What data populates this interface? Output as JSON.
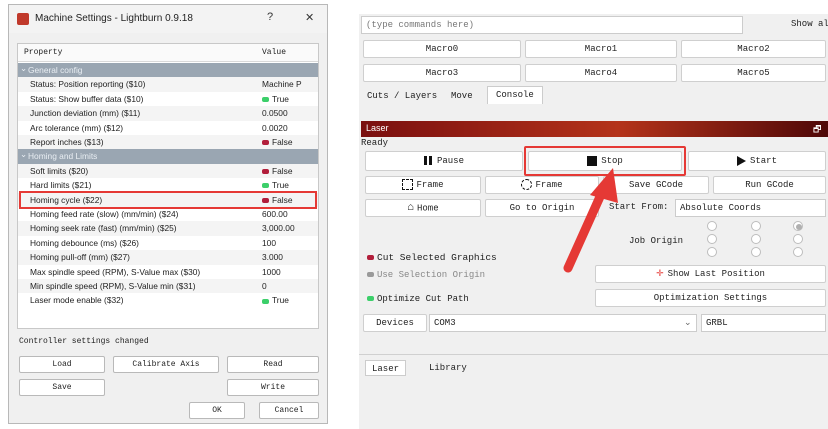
{
  "dialog": {
    "title": "Machine Settings - Lightburn 0.9.18",
    "help": "?",
    "close": "✕",
    "columns": {
      "property": "Property",
      "value": "Value"
    },
    "rows": [
      {
        "type": "section",
        "k": "General config",
        "v": ""
      },
      {
        "k": "Status: Position reporting ($10)",
        "v": "Machine P",
        "ind": ""
      },
      {
        "k": "Status: Show buffer data ($10)",
        "v": "True",
        "ind": "green"
      },
      {
        "k": "Junction deviation (mm) ($11)",
        "v": "0.0500",
        "ind": ""
      },
      {
        "k": "Arc tolerance (mm) ($12)",
        "v": "0.0020",
        "ind": ""
      },
      {
        "k": "Report inches ($13)",
        "v": "False",
        "ind": "red"
      },
      {
        "type": "section",
        "k": "Homing and Limits",
        "v": ""
      },
      {
        "k": "Soft limits ($20)",
        "v": "False",
        "ind": "red"
      },
      {
        "k": "Hard limits ($21)",
        "v": "True",
        "ind": "green"
      },
      {
        "k": "Homing cycle ($22)",
        "v": "False",
        "ind": "red",
        "highlight": true
      },
      {
        "k": "Homing feed rate (slow) (mm/min) ($24)",
        "v": "600.00",
        "ind": ""
      },
      {
        "k": "Homing seek rate (fast) (mm/min) ($25)",
        "v": "3,000.00",
        "ind": ""
      },
      {
        "k": "Homing debounce (ms) ($26)",
        "v": "100",
        "ind": ""
      },
      {
        "k": "Homing pull-off (mm) ($27)",
        "v": "3.000",
        "ind": ""
      },
      {
        "k": "Max spindle speed (RPM), S-Value max ($30)",
        "v": "1000",
        "ind": ""
      },
      {
        "k": "Min spindle speed (RPM), S-Value min ($31)",
        "v": "0",
        "ind": ""
      },
      {
        "k": "Laser mode enable ($32)",
        "v": "True",
        "ind": "green"
      }
    ],
    "status": "Controller settings changed",
    "buttons": {
      "load": "Load",
      "calibrate": "Calibrate Axis",
      "read": "Read",
      "save": "Save",
      "write": "Write",
      "ok": "OK",
      "cancel": "Cancel"
    }
  },
  "console": {
    "placeholder": "(type commands here)",
    "show_all": "Show all",
    "macros": [
      "Macro0",
      "Macro1",
      "Macro2",
      "Macro3",
      "Macro4",
      "Macro5"
    ],
    "tabs": [
      "Cuts / Layers",
      "Move",
      "Console"
    ]
  },
  "laser": {
    "title": "Laser",
    "pin": "🗗",
    "status": "Ready",
    "pause": "Pause",
    "stop": "Stop",
    "start": "Start",
    "frame1": "Frame",
    "frame2": "Frame",
    "save_gcode": "Save GCode",
    "run_gcode": "Run GCode",
    "home": "Home",
    "go_to_origin": "Go to Origin",
    "start_from_label": "Start From:",
    "start_from_value": "Absolute Coords",
    "job_origin": "Job Origin",
    "cut_selected": "Cut Selected Graphics",
    "use_selection_origin": "Use Selection Origin",
    "optimize_cut_path": "Optimize Cut Path",
    "show_last_position": "Show Last Position",
    "optimization_settings": "Optimization Settings",
    "devices": "Devices",
    "port": "COM3",
    "controller": "GRBL",
    "bottom_tabs": [
      "Laser",
      "Library"
    ]
  },
  "colors": {
    "highlight": "#e53935",
    "laser_bar": "#9b2a17",
    "true_green": "#3ccf6a",
    "false_red": "#b21e3b"
  }
}
